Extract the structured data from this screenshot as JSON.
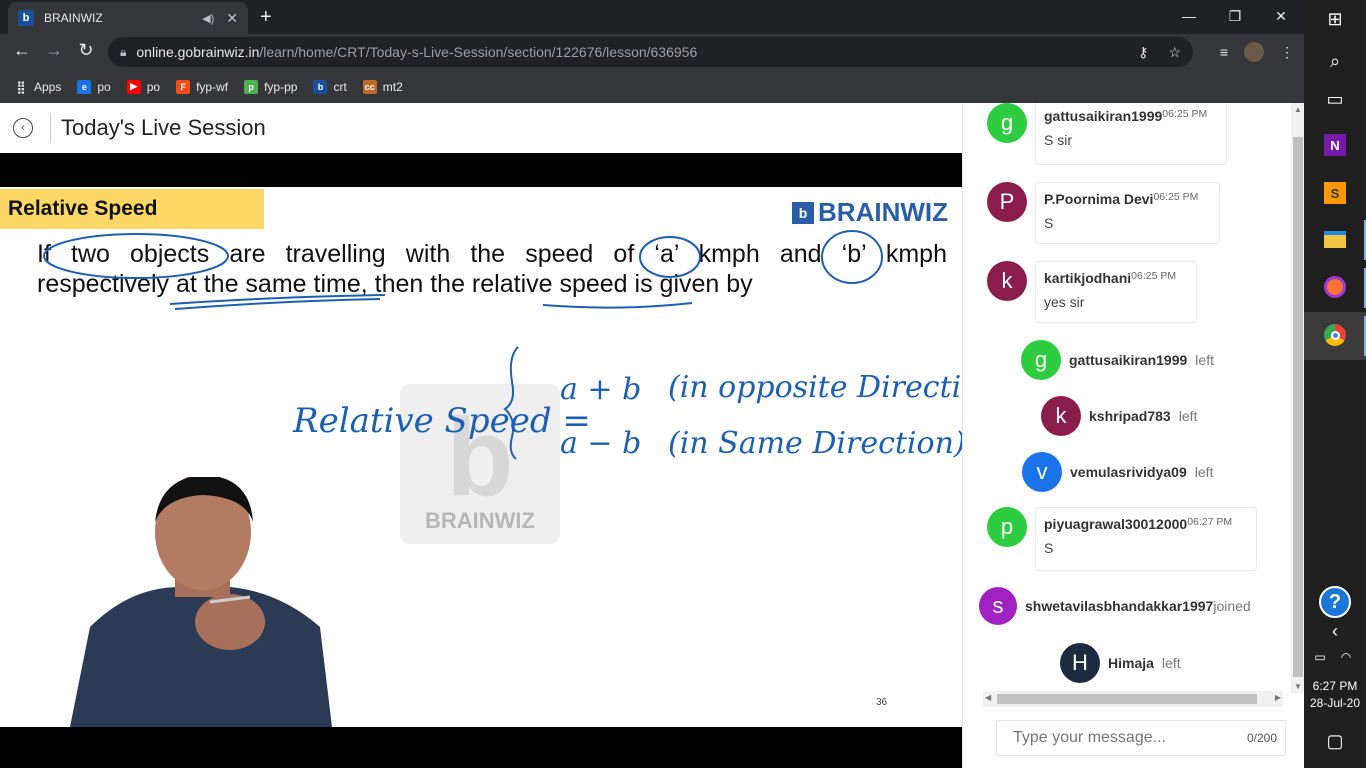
{
  "browser": {
    "tab_title": "BRAINWIZ",
    "tab_favicon": "b",
    "url_host": "online.gobrainwiz.in",
    "url_path": "/learn/home/CRT/Today-s-Live-Session/section/122676/lesson/636956",
    "bookmarks": [
      {
        "label": "Apps",
        "icon": "apps-grid-icon",
        "color": "#e8eaed"
      },
      {
        "label": "po",
        "icon": "edge-icon",
        "color": "#1a73e8"
      },
      {
        "label": "po",
        "icon": "youtube-icon",
        "color": "#ff0000"
      },
      {
        "label": "fyp-wf",
        "icon": "figma-icon",
        "color": "#f24e1e"
      },
      {
        "label": "fyp-pp",
        "icon": "pp-icon",
        "color": "#4caf50"
      },
      {
        "label": "crt",
        "icon": "brainwiz-icon",
        "color": "#1a4f9c"
      },
      {
        "label": "mt2",
        "icon": "cc-icon",
        "color": "#c0692b"
      }
    ]
  },
  "header": {
    "title": "Today's Live Session"
  },
  "slide": {
    "tag": "Relative Speed",
    "logo": "BRAINWIZ",
    "line1": "If two objects are travelling with the speed of ‘a’ kmph and ‘b’ kmph",
    "line2": "respectively at the same time, then the relative speed is given by",
    "watermark": "BRAINWIZ",
    "page_number": "36",
    "handwriting": {
      "label": "Relative Speed =",
      "row1_expr": "a + b",
      "row1_note": "(in opposite Direction)",
      "row2_expr": "a − b",
      "row2_note": "(in Same Direction)"
    }
  },
  "chat": {
    "messages": [
      {
        "initial": "g",
        "name": "gattusaikiran1999",
        "time": "06:25 PM",
        "text": "S sir",
        "color": "#2ecc40"
      },
      {
        "initial": "P",
        "name": "P.Poornima Devi",
        "time": "06:25 PM",
        "text": "S",
        "color": "#8b1d4d"
      },
      {
        "initial": "k",
        "name": "kartikjodhani",
        "time": "06:25 PM",
        "text": "yes sir",
        "color": "#8b1d4d"
      }
    ],
    "events": [
      {
        "initial": "g",
        "name": "gattusaikiran1999",
        "status": "left",
        "color": "#2ecc40"
      },
      {
        "initial": "k",
        "name": "kshripad783",
        "status": "left",
        "color": "#8b1d4d"
      },
      {
        "initial": "v",
        "name": "vemulasrividya09",
        "status": "left",
        "color": "#1a73e8"
      }
    ],
    "message4": {
      "initial": "p",
      "name": "piyuagrawal30012000",
      "time": "06:27 PM",
      "text": "S",
      "color": "#2ecc40"
    },
    "joined": {
      "initial": "s",
      "name": "shwetavilasbhandakkar1997",
      "status": "joined",
      "color": "#a020c0"
    },
    "last_event": {
      "initial": "H",
      "name": "Himaja",
      "status": "left",
      "color": "#1c2a40"
    },
    "input_placeholder": "Type your message...",
    "char_count": "0/200"
  },
  "taskbar": {
    "time": "6:27 PM",
    "date": "28-Jul-20"
  }
}
